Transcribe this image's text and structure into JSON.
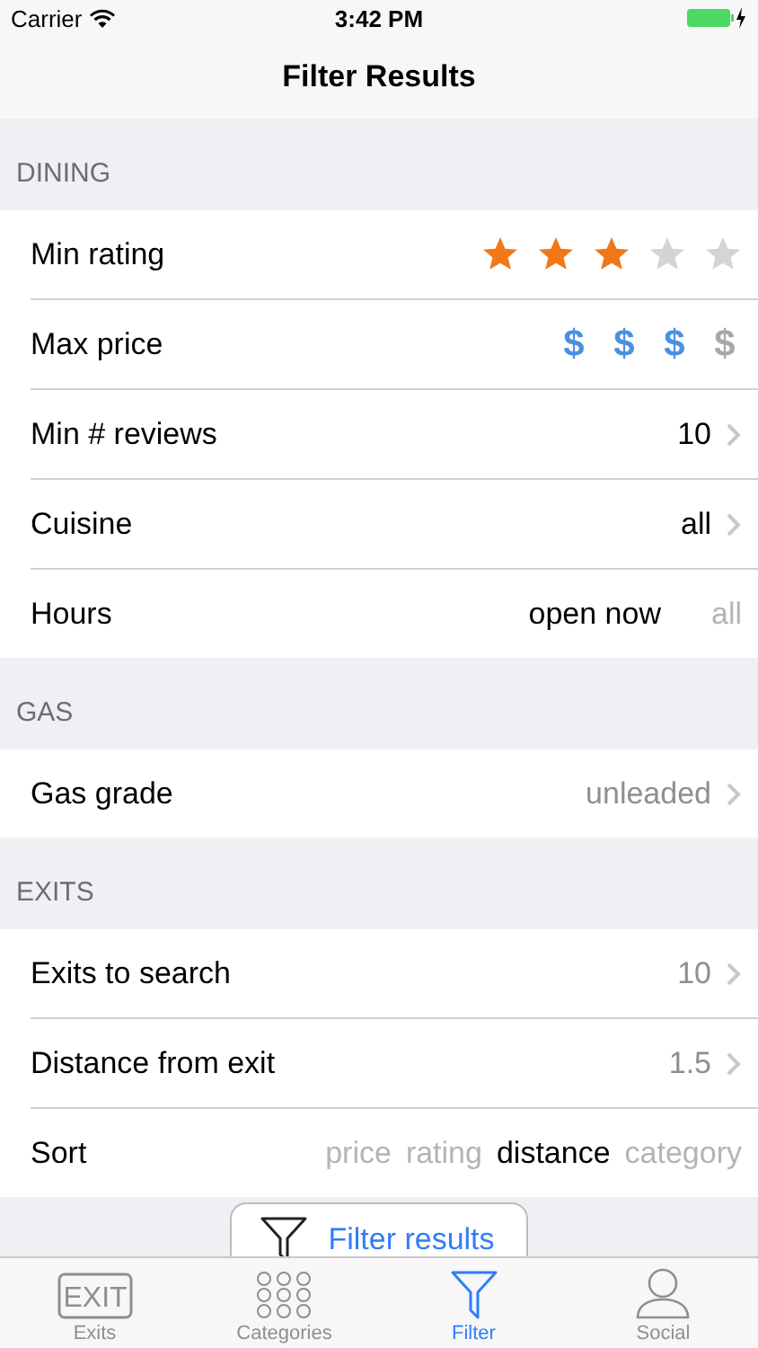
{
  "status_bar": {
    "carrier": "Carrier",
    "time": "3:42 PM"
  },
  "nav": {
    "title": "Filter Results"
  },
  "sections": [
    {
      "header": "DINING",
      "rows": [
        {
          "kind": "stars",
          "label": "Min rating",
          "stars": 3
        },
        {
          "kind": "prices",
          "label": "Max price",
          "options": [
            {
              "label": "$",
              "on": true
            },
            {
              "label": "$",
              "on": true
            },
            {
              "label": "$",
              "on": true
            },
            {
              "label": "$",
              "on": false
            }
          ]
        },
        {
          "kind": "value",
          "label": "Min # reviews",
          "value": "10",
          "value_dark": true
        },
        {
          "kind": "value",
          "label": "Cuisine",
          "value": "all",
          "value_dark": true
        },
        {
          "kind": "choice",
          "label": "Hours",
          "options": [
            {
              "label": "open now",
              "selected": true
            },
            {
              "label": "all",
              "selected": false
            }
          ]
        }
      ]
    },
    {
      "header": "GAS",
      "rows": [
        {
          "kind": "value",
          "label": "Gas grade",
          "value": "unleaded",
          "value_dark": false
        }
      ]
    },
    {
      "header": "EXITS",
      "rows": [
        {
          "kind": "value",
          "label": "Exits to search",
          "value": "10",
          "value_dark": false
        },
        {
          "kind": "value",
          "label": "Distance from exit",
          "value": "1.5",
          "value_dark": false
        },
        {
          "kind": "choice",
          "label": "Sort",
          "options": [
            {
              "label": "price",
              "selected": false
            },
            {
              "label": "rating",
              "selected": false
            },
            {
              "label": "distance",
              "selected": true
            },
            {
              "label": "category",
              "selected": false
            }
          ]
        }
      ]
    }
  ],
  "action_button": {
    "label": "Filter results"
  },
  "tabs": [
    {
      "kind": "exit",
      "label": "Exits",
      "badge": "EXIT",
      "selected": false
    },
    {
      "kind": "grid",
      "label": "Categories",
      "selected": false
    },
    {
      "kind": "filter",
      "label": "Filter",
      "selected": true
    },
    {
      "kind": "person",
      "label": "Social",
      "selected": false
    }
  ]
}
